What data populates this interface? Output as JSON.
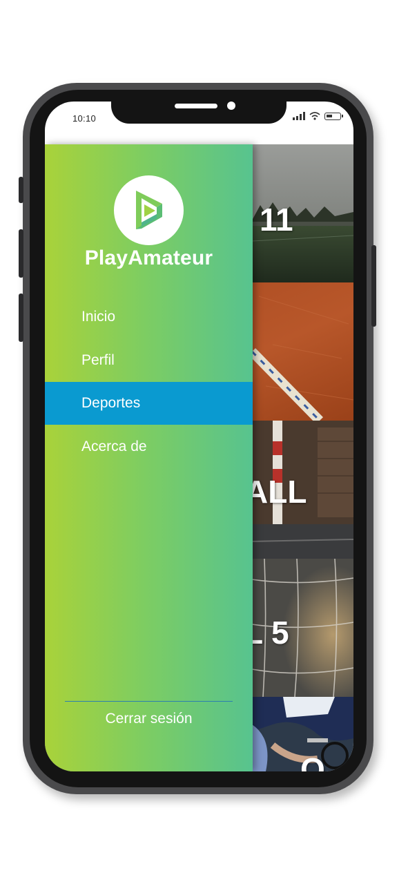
{
  "status_bar": {
    "time": "10:10"
  },
  "drawer": {
    "brand": "PlayAmateur",
    "menu": [
      {
        "label": "Inicio",
        "active": false
      },
      {
        "label": "Perfil",
        "active": false
      },
      {
        "label": "Deportes",
        "active": true
      },
      {
        "label": "Acerca de",
        "active": false
      }
    ],
    "logout_label": "Cerrar sesión"
  },
  "sports_list": [
    {
      "visible_title": "11"
    },
    {
      "visible_title": ""
    },
    {
      "visible_title": "ALL"
    },
    {
      "visible_title": "L 5"
    },
    {
      "visible_title": "O"
    }
  ],
  "colors": {
    "drawer_gradient_start": "#a9d23a",
    "drawer_gradient_end": "#57c38f",
    "active_item": "#0a9ad0",
    "divider": "#2b7fb0"
  }
}
